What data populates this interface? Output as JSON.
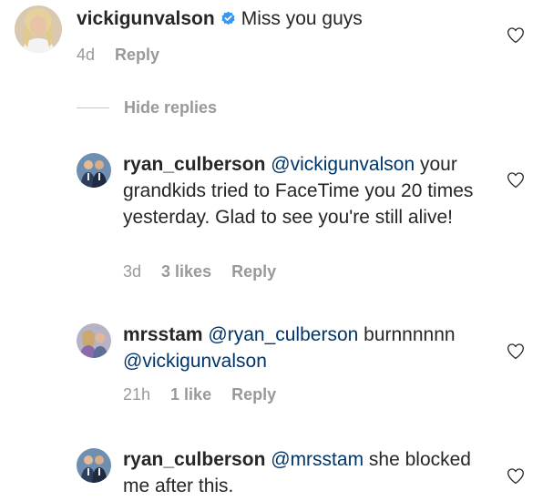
{
  "comments": [
    {
      "username": "vickigunvalson",
      "verified": true,
      "text": "Miss you guys",
      "time": "4d",
      "reply_label": "Reply"
    },
    {
      "username": "ryan_culberson",
      "mention": "@vickigunvalson",
      "text": "your grandkids tried to FaceTime you 20 times yesterday. Glad to see you're still alive!",
      "time": "3d",
      "likes": "3 likes",
      "reply_label": "Reply"
    },
    {
      "username": "mrsstam",
      "mention": "@ryan_culberson",
      "text_before": "burnnnnnn",
      "mention2": "@vickigunvalson",
      "time": "21h",
      "likes": "1 like",
      "reply_label": "Reply"
    },
    {
      "username": "ryan_culberson",
      "mention": "@mrsstam",
      "text": "she blocked me after this."
    }
  ],
  "hide_replies_label": "Hide replies",
  "icons": {
    "like": "heart-outline-icon",
    "verified": "verified-badge-icon"
  },
  "colors": {
    "mention": "#003569",
    "meta": "#999999",
    "text": "#262626",
    "verified": "#3897f0"
  }
}
